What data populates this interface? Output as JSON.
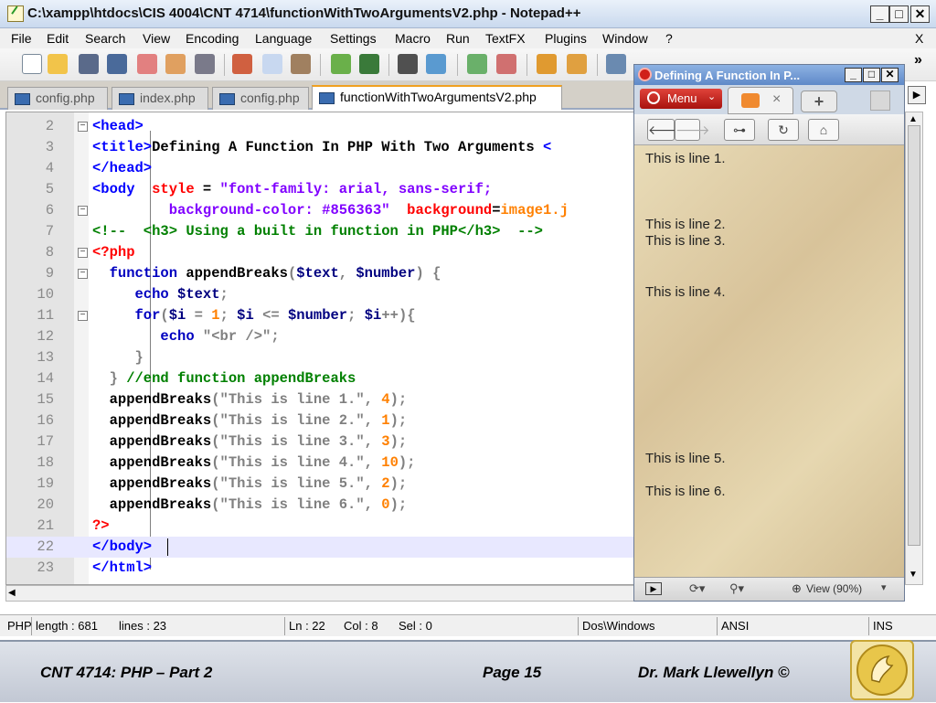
{
  "window": {
    "title": "C:\\xampp\\htdocs\\CIS 4004\\CNT 4714\\functionWithTwoArgumentsV2.php - Notepad++"
  },
  "menu": [
    "File",
    "Edit",
    "Search",
    "View",
    "Encoding",
    "Language",
    "Settings",
    "Macro",
    "Run",
    "TextFX",
    "Plugins",
    "Window",
    "?"
  ],
  "menu_close": "X",
  "toolbar_overflow": "»",
  "tabs": [
    "config.php",
    "index.php",
    "config.php",
    "functionWithTwoArgumentsV2.php"
  ],
  "editor": {
    "current_line": "22",
    "lines": [
      {
        "n": "2",
        "parts": [
          {
            "t": "<head>",
            "c": "t"
          }
        ]
      },
      {
        "n": "3",
        "parts": [
          {
            "t": "<title>",
            "c": "t"
          },
          {
            "t": "Defining A Function In PHP With Two Arguments ",
            "c": "d"
          },
          {
            "t": "<",
            "c": "t"
          }
        ]
      },
      {
        "n": "4",
        "parts": [
          {
            "t": "</head>",
            "c": "t"
          }
        ]
      },
      {
        "n": "5",
        "parts": [
          {
            "t": "<body ",
            "c": "t"
          },
          {
            "t": " style",
            "c": "a"
          },
          {
            "t": " = ",
            "c": "d"
          },
          {
            "t": "\"font-family: arial, sans-serif;",
            "c": "av"
          }
        ]
      },
      {
        "n": "6",
        "parts": [
          {
            "t": "         background-color: #856363\"",
            "c": "av"
          },
          {
            "t": "  background",
            "c": "a"
          },
          {
            "t": "=",
            "c": "d"
          },
          {
            "t": "image1.j",
            "c": "n"
          }
        ]
      },
      {
        "n": "7",
        "parts": [
          {
            "t": "<!--  <h3> Using a built in function in PHP</h3>  -->",
            "c": "c"
          }
        ]
      },
      {
        "n": "8",
        "parts": [
          {
            "t": "<?php",
            "c": "a"
          }
        ]
      },
      {
        "n": "9",
        "parts": [
          {
            "t": "  function",
            "c": "k"
          },
          {
            "t": " appendBreaks",
            "c": "d"
          },
          {
            "t": "(",
            "c": "s"
          },
          {
            "t": "$text",
            "c": "v"
          },
          {
            "t": ", ",
            "c": "s"
          },
          {
            "t": "$number",
            "c": "v"
          },
          {
            "t": ") {",
            "c": "s"
          }
        ]
      },
      {
        "n": "10",
        "parts": [
          {
            "t": "     echo",
            "c": "k"
          },
          {
            "t": " $text",
            "c": "v"
          },
          {
            "t": ";",
            "c": "s"
          }
        ]
      },
      {
        "n": "11",
        "parts": [
          {
            "t": "     for",
            "c": "k"
          },
          {
            "t": "(",
            "c": "s"
          },
          {
            "t": "$i",
            "c": "v"
          },
          {
            "t": " = ",
            "c": "s"
          },
          {
            "t": "1",
            "c": "n"
          },
          {
            "t": "; ",
            "c": "s"
          },
          {
            "t": "$i",
            "c": "v"
          },
          {
            "t": " <= ",
            "c": "s"
          },
          {
            "t": "$number",
            "c": "v"
          },
          {
            "t": "; ",
            "c": "s"
          },
          {
            "t": "$i",
            "c": "v"
          },
          {
            "t": "++){",
            "c": "s"
          }
        ]
      },
      {
        "n": "12",
        "parts": [
          {
            "t": "        echo",
            "c": "k"
          },
          {
            "t": " \"<br />\"",
            "c": "s"
          },
          {
            "t": ";",
            "c": "s"
          }
        ]
      },
      {
        "n": "13",
        "parts": [
          {
            "t": "     }",
            "c": "s"
          }
        ]
      },
      {
        "n": "14",
        "parts": [
          {
            "t": "  }",
            "c": "s"
          },
          {
            "t": " //end function appendBreaks",
            "c": "c"
          }
        ]
      },
      {
        "n": "15",
        "parts": [
          {
            "t": "  appendBreaks",
            "c": "d"
          },
          {
            "t": "(\"This is line 1.\", ",
            "c": "s"
          },
          {
            "t": "4",
            "c": "n"
          },
          {
            "t": ");",
            "c": "s"
          }
        ]
      },
      {
        "n": "16",
        "parts": [
          {
            "t": "  appendBreaks",
            "c": "d"
          },
          {
            "t": "(\"This is line 2.\", ",
            "c": "s"
          },
          {
            "t": "1",
            "c": "n"
          },
          {
            "t": ");",
            "c": "s"
          }
        ]
      },
      {
        "n": "17",
        "parts": [
          {
            "t": "  appendBreaks",
            "c": "d"
          },
          {
            "t": "(\"This is line 3.\", ",
            "c": "s"
          },
          {
            "t": "3",
            "c": "n"
          },
          {
            "t": ");",
            "c": "s"
          }
        ]
      },
      {
        "n": "18",
        "parts": [
          {
            "t": "  appendBreaks",
            "c": "d"
          },
          {
            "t": "(\"This is line 4.\", ",
            "c": "s"
          },
          {
            "t": "10",
            "c": "n"
          },
          {
            "t": ");",
            "c": "s"
          }
        ]
      },
      {
        "n": "19",
        "parts": [
          {
            "t": "  appendBreaks",
            "c": "d"
          },
          {
            "t": "(\"This is line 5.\", ",
            "c": "s"
          },
          {
            "t": "2",
            "c": "n"
          },
          {
            "t": ");",
            "c": "s"
          }
        ]
      },
      {
        "n": "20",
        "parts": [
          {
            "t": "  appendBreaks",
            "c": "d"
          },
          {
            "t": "(\"This is line 6.\", ",
            "c": "s"
          },
          {
            "t": "0",
            "c": "n"
          },
          {
            "t": ");",
            "c": "s"
          }
        ]
      },
      {
        "n": "21",
        "parts": [
          {
            "t": "?>",
            "c": "a"
          }
        ]
      },
      {
        "n": "22",
        "parts": [
          {
            "t": "</body>",
            "c": "t"
          }
        ]
      },
      {
        "n": "23",
        "parts": [
          {
            "t": "</html>",
            "c": "t"
          }
        ]
      }
    ]
  },
  "status": {
    "type": "PHP",
    "length": "length : 681",
    "lines": "lines : 23",
    "ln": "Ln : 22",
    "col": "Col : 8",
    "sel": "Sel : 0",
    "eol": "Dos\\Windows",
    "encoding": "ANSI",
    "mode": "INS"
  },
  "browser": {
    "title": "Defining A Function In P...",
    "menu": "Menu",
    "zoom": "View (90%)",
    "output": [
      "This is line 1.",
      "This is line 2.",
      "This is line 3.",
      "This is line 4.",
      "This is line 5.",
      "This is line 6."
    ]
  },
  "footer": {
    "course": "CNT 4714:  PHP – Part 2",
    "page": "Page 15",
    "author": "Dr. Mark Llewellyn ©"
  }
}
